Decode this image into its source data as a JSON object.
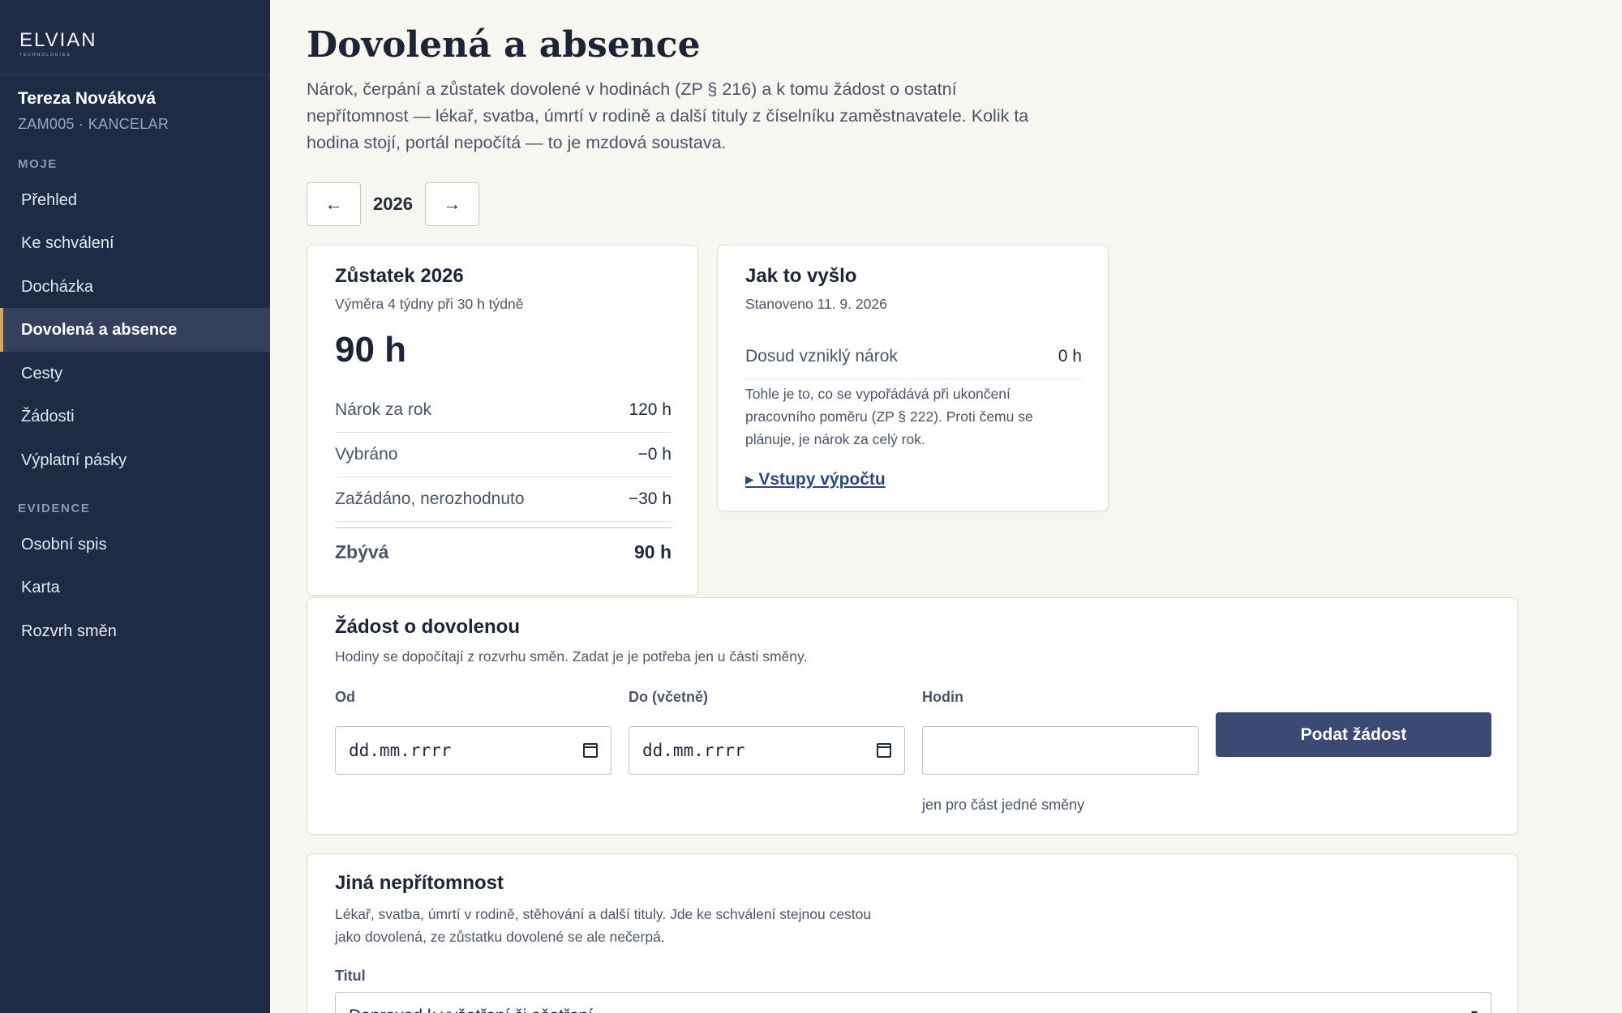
{
  "brand": {
    "logo": "ELVIAN",
    "logo_sub": "TECHNOLOGIES"
  },
  "user": {
    "name": "Tereza Nováková",
    "meta": "ZAM005 · KANCELAR"
  },
  "sidebar": {
    "section_mine": "MOJE",
    "mine_items": [
      {
        "label": "Přehled"
      },
      {
        "label": "Ke schválení"
      },
      {
        "label": "Docházka"
      },
      {
        "label": "Dovolená a absence"
      },
      {
        "label": "Cesty"
      },
      {
        "label": "Žádosti"
      },
      {
        "label": "Výplatní pásky"
      }
    ],
    "section_records": "EVIDENCE",
    "records_items": [
      {
        "label": "Osobní spis"
      },
      {
        "label": "Karta"
      },
      {
        "label": "Rozvrh směn"
      }
    ]
  },
  "page": {
    "title": "Dovolená a absence",
    "description": "Nárok, čerpání a zůstatek dovolené v hodinách (ZP § 216) a k tomu žádost o ostatní nepřítomnost — lékař, svatba, úmrtí v rodině a další tituly z číselníku zaměstnavatele. Kolik ta hodina stojí, portál nepočítá — to je mzdová soustava."
  },
  "year_nav": {
    "prev": "←",
    "year": "2026",
    "next": "→"
  },
  "balance_card": {
    "title": "Zůstatek 2026",
    "subtitle": "Výměra 4 týdny při 30 h týdně",
    "big_value": "90 h",
    "rows": [
      {
        "label": "Nárok za rok",
        "value": "120 h"
      },
      {
        "label": "Vybráno",
        "value": "−0 h"
      },
      {
        "label": "Zažádáno, nerozhodnuto",
        "value": "−30 h"
      }
    ],
    "total_label": "Zbývá",
    "total_value": "90 h"
  },
  "result_card": {
    "title": "Jak to vyšlo",
    "subtitle": "Stanoveno 11. 9. 2026",
    "row_label": "Dosud vzniklý nárok",
    "row_value": "0 h",
    "note": "Tohle je to, co se vypořádává při ukončení pracovního poměru (ZP § 222). Proti čemu se plánuje, je nárok za celý rok.",
    "link": "▸ Vstupy výpočtu"
  },
  "leave_request": {
    "title": "Žádost o dovolenou",
    "subtitle": "Hodiny se dopočítají z rozvrhu směn. Zadat je je potřeba jen u části směny.",
    "from_label": "Od",
    "from_value": "dd.mm.rrrr",
    "to_label": "Do (včetně)",
    "to_value": "dd.mm.rrrr",
    "hours_label": "Hodin",
    "hours_value": "",
    "hours_hint": "jen pro část jedné směny",
    "submit": "Podat žádost"
  },
  "other_absence": {
    "title": "Jiná nepřítomnost",
    "subtitle": "Lékař, svatba, úmrtí v rodině, stěhování a další tituly. Jde ke schválení stejnou cestou jako dovolená, ze zůstatku dovolené se ale nečerpá.",
    "type_label": "Titul",
    "type_value": "Doprovod k vyšetření či ošetření"
  },
  "colors": {
    "sidebar_bg": "#1f2a44",
    "accent": "#d6a85a",
    "primary_button": "#3a4a72",
    "page_bg": "#f8f6f1"
  }
}
